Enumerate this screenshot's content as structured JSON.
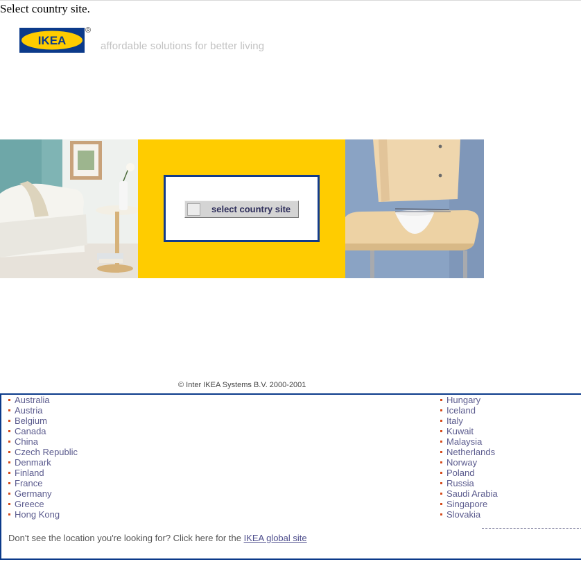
{
  "page": {
    "heading": "Select country site.",
    "logo_text": "IKEA",
    "registered_mark": "®",
    "tagline": "affordable solutions for better living"
  },
  "banner": {
    "button_label": "select country site"
  },
  "copyright": "© Inter IKEA Systems B.V. 2000-2001",
  "countries": {
    "left": [
      "Australia",
      "Austria",
      "Belgium",
      "Canada",
      "China",
      "Czech Republic",
      "Denmark",
      "Finland",
      "France",
      "Germany",
      "Greece",
      "Hong Kong"
    ],
    "right": [
      "Hungary",
      "Iceland",
      "Italy",
      "Kuwait",
      "Malaysia",
      "Netherlands",
      "Norway",
      "Poland",
      "Russia",
      "Saudi Arabia",
      "Singapore",
      "Slovakia"
    ]
  },
  "footer": {
    "notice_text": "Don't see the location you're looking for? Click here for the",
    "global_link": "IKEA global site"
  },
  "colors": {
    "ikea_blue": "#0b3a8a",
    "ikea_yellow": "#ffcc00",
    "bullet": "#d44b1c",
    "link": "#5b5b8e"
  }
}
